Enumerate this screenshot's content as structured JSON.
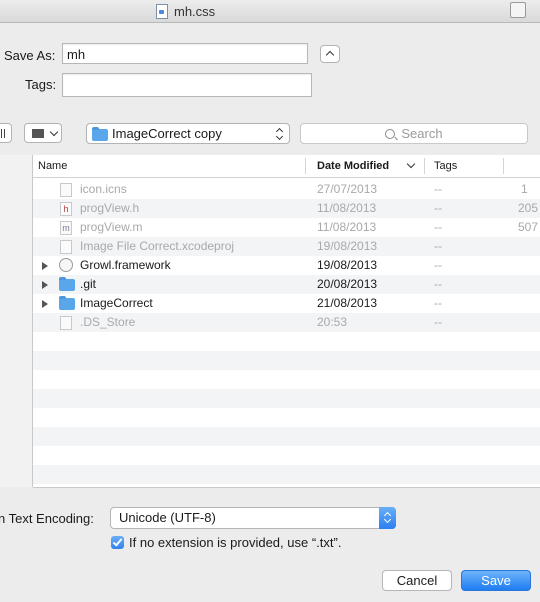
{
  "window": {
    "title": "mh.css"
  },
  "save_as": {
    "label": "Save As:",
    "value": "mh"
  },
  "tags": {
    "label": "Tags:",
    "value": ""
  },
  "location": {
    "folder": "ImageCorrect copy"
  },
  "search": {
    "placeholder": "Search"
  },
  "columns": {
    "name": "Name",
    "date": "Date Modified",
    "tags": "Tags"
  },
  "files": [
    {
      "name": "icon.icns",
      "date": "27/07/2013",
      "tags": "--",
      "extra": "1",
      "enabled": false,
      "kind": "file"
    },
    {
      "name": "progView.h",
      "date": "11/08/2013",
      "tags": "--",
      "extra": "205",
      "enabled": false,
      "kind": "h"
    },
    {
      "name": "progView.m",
      "date": "11/08/2013",
      "tags": "--",
      "extra": "507",
      "enabled": false,
      "kind": "m"
    },
    {
      "name": "Image File Correct.xcodeproj",
      "date": "19/08/2013",
      "tags": "--",
      "extra": "",
      "enabled": false,
      "kind": "file"
    },
    {
      "name": "Growl.framework",
      "date": "19/08/2013",
      "tags": "--",
      "extra": "",
      "enabled": true,
      "kind": "bundle"
    },
    {
      "name": ".git",
      "date": "20/08/2013",
      "tags": "--",
      "extra": "",
      "enabled": true,
      "kind": "folder"
    },
    {
      "name": "ImageCorrect",
      "date": "21/08/2013",
      "tags": "--",
      "extra": "",
      "enabled": true,
      "kind": "folder"
    },
    {
      "name": ".DS_Store",
      "date": "20:53",
      "tags": "--",
      "extra": "",
      "enabled": false,
      "kind": "file"
    }
  ],
  "encoding": {
    "label": "n Text Encoding:",
    "value": "Unicode (UTF-8)"
  },
  "extension_checkbox": {
    "label": "If no extension is provided, use “.txt”.",
    "checked": true
  },
  "buttons": {
    "cancel": "Cancel",
    "save": "Save"
  },
  "colors": {
    "accent": "#2b7ff0",
    "folder": "#5aa6ea"
  }
}
